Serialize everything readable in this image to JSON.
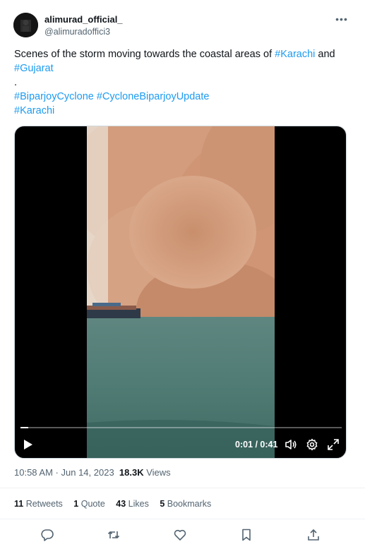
{
  "author": {
    "display_name": "alimurad_official_",
    "handle": "@alimuradoffici3"
  },
  "more_icon": "more-horizontal-icon",
  "tweet": {
    "line1_prefix": "Scenes of the storm moving towards the coastal areas of ",
    "line1_tag": "#Karachi",
    "line1_suffix": " and",
    "line2_tag": "#Gujarat",
    "line3": ".",
    "line4_tag1": "#BiparjoyCyclone",
    "line4_tag2": "#CycloneBiparjoyUpdate",
    "line5_tag": "#Karachi"
  },
  "video": {
    "timestamp": "0:01 / 0:41",
    "progress": 0.024,
    "play_icon": "play-icon",
    "volume_icon": "volume-icon",
    "settings_icon": "gear-icon",
    "fullscreen_icon": "fullscreen-icon"
  },
  "meta": {
    "time": "10:58 AM",
    "separator": " · ",
    "date": "Jun 14, 2023",
    "views_count": "18.3K",
    "views_label": " Views"
  },
  "stats": {
    "retweets_count": "11",
    "retweets_label": " Retweets",
    "quotes_count": "1",
    "quotes_label": " Quote",
    "likes_count": "43",
    "likes_label": " Likes",
    "bookmarks_count": "5",
    "bookmarks_label": " Bookmarks"
  },
  "actions": [
    "reply-icon",
    "retweet-icon",
    "like-icon",
    "bookmark-icon",
    "share-icon"
  ],
  "colors": {
    "link": "#1d9bf0",
    "secondary_text": "#536471",
    "primary_text": "#0f1419"
  }
}
